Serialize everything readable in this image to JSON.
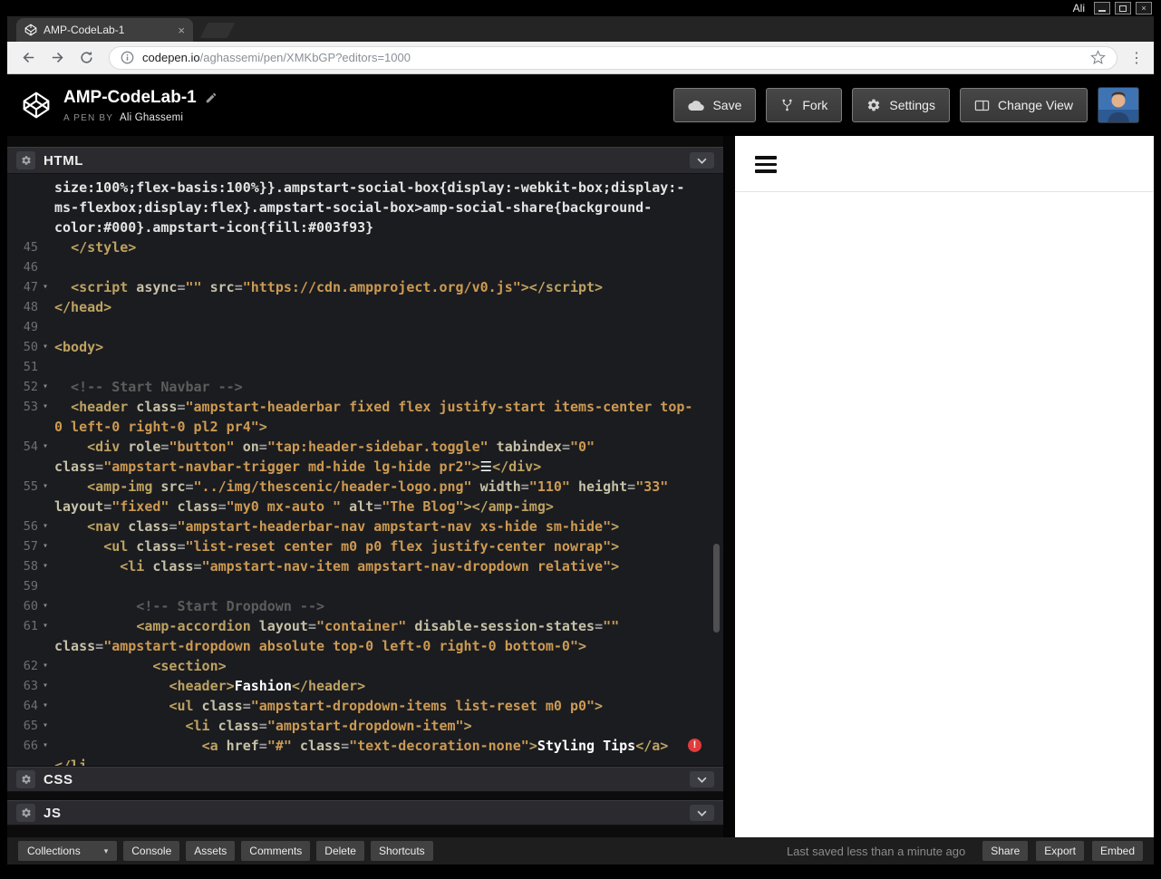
{
  "system_bar": {
    "username": "Ali",
    "window_controls": [
      "minimize",
      "maximize",
      "close"
    ]
  },
  "browser": {
    "tab_title": "AMP-CodeLab-1",
    "tab_close": "×",
    "url_domain": "codepen.io",
    "url_path": "/aghassemi/pen/XMKbGP?editors=1000"
  },
  "header": {
    "title": "AMP-CodeLab-1",
    "byline_prefix": "A PEN BY",
    "author": "Ali Ghassemi",
    "save_label": "Save",
    "fork_label": "Fork",
    "settings_label": "Settings",
    "change_view_label": "Change View"
  },
  "panels": {
    "html": {
      "label": "HTML"
    },
    "css": {
      "label": "CSS"
    },
    "js": {
      "label": "JS"
    }
  },
  "editor": {
    "rows": [
      {
        "num": "",
        "fold": false,
        "segments": [
          [
            "css",
            "size:100%;flex-basis:100%}}.ampstart-social-box{display:-webkit-box;display:-"
          ]
        ]
      },
      {
        "num": "",
        "fold": false,
        "segments": [
          [
            "css",
            "ms-flexbox;display:flex}.ampstart-social-box>amp-social-share{background-"
          ]
        ]
      },
      {
        "num": "",
        "fold": false,
        "segments": [
          [
            "css",
            "color:#000}.ampstart-icon{fill:#003f93}"
          ]
        ]
      },
      {
        "num": "45",
        "fold": false,
        "segments": [
          [
            "plain",
            "  "
          ],
          [
            "tag",
            "</style>"
          ]
        ]
      },
      {
        "num": "46",
        "fold": false,
        "segments": []
      },
      {
        "num": "47",
        "fold": true,
        "segments": [
          [
            "plain",
            "  "
          ],
          [
            "tag",
            "<script"
          ],
          [
            "attr",
            " async"
          ],
          [
            "punct",
            "="
          ],
          [
            "str",
            "\"\""
          ],
          [
            "attr",
            " src"
          ],
          [
            "punct",
            "="
          ],
          [
            "str",
            "\"https://cdn.ampproject.org/v0.js\""
          ],
          [
            "tag",
            "></script>"
          ]
        ]
      },
      {
        "num": "48",
        "fold": false,
        "segments": [
          [
            "tag",
            "</head>"
          ]
        ]
      },
      {
        "num": "49",
        "fold": false,
        "segments": []
      },
      {
        "num": "50",
        "fold": true,
        "segments": [
          [
            "tag",
            "<body>"
          ]
        ]
      },
      {
        "num": "51",
        "fold": false,
        "segments": []
      },
      {
        "num": "52",
        "fold": true,
        "segments": [
          [
            "comment",
            "  <!-- Start Navbar -->"
          ]
        ]
      },
      {
        "num": "53",
        "fold": true,
        "segments": [
          [
            "plain",
            "  "
          ],
          [
            "tag",
            "<header"
          ],
          [
            "attr",
            " class"
          ],
          [
            "punct",
            "="
          ],
          [
            "str",
            "\"ampstart-headerbar fixed flex justify-start items-center top-"
          ]
        ]
      },
      {
        "num": "",
        "fold": false,
        "segments": [
          [
            "str",
            "0 left-0 right-0 pl2 pr4\""
          ],
          [
            "tag",
            ">"
          ]
        ]
      },
      {
        "num": "54",
        "fold": true,
        "segments": [
          [
            "plain",
            "    "
          ],
          [
            "tag",
            "<div"
          ],
          [
            "attr",
            " role"
          ],
          [
            "punct",
            "="
          ],
          [
            "str",
            "\"button\""
          ],
          [
            "attr",
            " on"
          ],
          [
            "punct",
            "="
          ],
          [
            "str",
            "\"tap:header-sidebar.toggle\""
          ],
          [
            "attr",
            " tabindex"
          ],
          [
            "punct",
            "="
          ],
          [
            "str",
            "\"0\""
          ]
        ]
      },
      {
        "num": "",
        "fold": false,
        "segments": [
          [
            "attr",
            "class"
          ],
          [
            "punct",
            "="
          ],
          [
            "str",
            "\"ampstart-navbar-trigger md-hide lg-hide pr2\""
          ],
          [
            "tag",
            ">"
          ],
          [
            "text",
            "☰"
          ],
          [
            "tag",
            "</div>"
          ]
        ]
      },
      {
        "num": "55",
        "fold": true,
        "segments": [
          [
            "plain",
            "    "
          ],
          [
            "tag",
            "<amp-img"
          ],
          [
            "attr",
            " src"
          ],
          [
            "punct",
            "="
          ],
          [
            "str",
            "\"../img/thescenic/header-logo.png\""
          ],
          [
            "attr",
            " width"
          ],
          [
            "punct",
            "="
          ],
          [
            "str",
            "\"110\""
          ],
          [
            "attr",
            " height"
          ],
          [
            "punct",
            "="
          ],
          [
            "str",
            "\"33\""
          ]
        ]
      },
      {
        "num": "",
        "fold": false,
        "segments": [
          [
            "attr",
            "layout"
          ],
          [
            "punct",
            "="
          ],
          [
            "str",
            "\"fixed\""
          ],
          [
            "attr",
            " class"
          ],
          [
            "punct",
            "="
          ],
          [
            "str",
            "\"my0 mx-auto \""
          ],
          [
            "attr",
            " alt"
          ],
          [
            "punct",
            "="
          ],
          [
            "str",
            "\"The Blog\""
          ],
          [
            "tag",
            "></amp-img>"
          ]
        ]
      },
      {
        "num": "56",
        "fold": true,
        "segments": [
          [
            "plain",
            "    "
          ],
          [
            "tag",
            "<nav"
          ],
          [
            "attr",
            " class"
          ],
          [
            "punct",
            "="
          ],
          [
            "str",
            "\"ampstart-headerbar-nav ampstart-nav xs-hide sm-hide\""
          ],
          [
            "tag",
            ">"
          ]
        ]
      },
      {
        "num": "57",
        "fold": true,
        "segments": [
          [
            "plain",
            "      "
          ],
          [
            "tag",
            "<ul"
          ],
          [
            "attr",
            " class"
          ],
          [
            "punct",
            "="
          ],
          [
            "str",
            "\"list-reset center m0 p0 flex justify-center nowrap\""
          ],
          [
            "tag",
            ">"
          ]
        ]
      },
      {
        "num": "58",
        "fold": true,
        "segments": [
          [
            "plain",
            "        "
          ],
          [
            "tag",
            "<li"
          ],
          [
            "attr",
            " class"
          ],
          [
            "punct",
            "="
          ],
          [
            "str",
            "\"ampstart-nav-item ampstart-nav-dropdown relative\""
          ],
          [
            "tag",
            ">"
          ]
        ]
      },
      {
        "num": "59",
        "fold": false,
        "segments": []
      },
      {
        "num": "60",
        "fold": true,
        "segments": [
          [
            "comment",
            "          <!-- Start Dropdown -->"
          ]
        ]
      },
      {
        "num": "61",
        "fold": true,
        "segments": [
          [
            "plain",
            "          "
          ],
          [
            "tag",
            "<amp-accordion"
          ],
          [
            "attr",
            " layout"
          ],
          [
            "punct",
            "="
          ],
          [
            "str",
            "\"container\""
          ],
          [
            "attr",
            " disable-session-states"
          ],
          [
            "punct",
            "="
          ],
          [
            "str",
            "\"\""
          ]
        ]
      },
      {
        "num": "",
        "fold": false,
        "segments": [
          [
            "attr",
            "class"
          ],
          [
            "punct",
            "="
          ],
          [
            "str",
            "\"ampstart-dropdown absolute top-0 left-0 right-0 bottom-0\""
          ],
          [
            "tag",
            ">"
          ]
        ]
      },
      {
        "num": "62",
        "fold": true,
        "segments": [
          [
            "plain",
            "            "
          ],
          [
            "tag",
            "<section>"
          ]
        ]
      },
      {
        "num": "63",
        "fold": true,
        "segments": [
          [
            "plain",
            "              "
          ],
          [
            "tag",
            "<header>"
          ],
          [
            "text",
            "Fashion"
          ],
          [
            "tag",
            "</header>"
          ]
        ]
      },
      {
        "num": "64",
        "fold": true,
        "segments": [
          [
            "plain",
            "              "
          ],
          [
            "tag",
            "<ul"
          ],
          [
            "attr",
            " class"
          ],
          [
            "punct",
            "="
          ],
          [
            "str",
            "\"ampstart-dropdown-items list-reset m0 p0\""
          ],
          [
            "tag",
            ">"
          ]
        ]
      },
      {
        "num": "65",
        "fold": true,
        "segments": [
          [
            "plain",
            "                "
          ],
          [
            "tag",
            "<li"
          ],
          [
            "attr",
            " class"
          ],
          [
            "punct",
            "="
          ],
          [
            "str",
            "\"ampstart-dropdown-item\""
          ],
          [
            "tag",
            ">"
          ]
        ]
      },
      {
        "num": "66",
        "fold": true,
        "error": true,
        "segments": [
          [
            "plain",
            "                  "
          ],
          [
            "tag",
            "<a"
          ],
          [
            "attr",
            " href"
          ],
          [
            "punct",
            "="
          ],
          [
            "str",
            "\"#\""
          ],
          [
            "attr",
            " class"
          ],
          [
            "punct",
            "="
          ],
          [
            "str",
            "\"text-decoration-none\""
          ],
          [
            "tag",
            ">"
          ],
          [
            "text",
            "Styling Tips"
          ],
          [
            "tag",
            "</a>"
          ]
        ]
      },
      {
        "num": "",
        "fold": false,
        "segments": [
          [
            "tag",
            "</li"
          ]
        ]
      }
    ],
    "error_glyph": "!"
  },
  "footer": {
    "collections_label": "Collections",
    "buttons_left": [
      "Console",
      "Assets",
      "Comments",
      "Delete",
      "Shortcuts"
    ],
    "status": "Last saved less than a minute ago",
    "buttons_right": [
      "Share",
      "Export",
      "Embed"
    ]
  },
  "icons": {
    "codepen-logo-icon": "cube-outline",
    "pencil-icon": "pencil",
    "save-icon": "cloud",
    "fork-icon": "git-fork",
    "settings-icon": "gear",
    "change-view-icon": "layout-split",
    "back-icon": "arrow-left",
    "forward-icon": "arrow-right",
    "reload-icon": "refresh",
    "info-icon": "info-circle",
    "star-icon": "star-outline",
    "overflow-menu-icon": "vertical-dots",
    "chevron-down-icon": "chevron-down",
    "panel-settings-icon": "gear",
    "lint-error-icon": "exclamation-circle",
    "hamburger-icon": "three-bars",
    "fold-arrow-icon": "triangle-down"
  },
  "colors": {
    "error_red": "#e03c3c",
    "editor_bg": "#1b1c20",
    "panel_header_bg": "#2a2a2f",
    "tag": "#bda262",
    "string": "#cc9a52",
    "comment": "#5d5d5d",
    "footer_bg": "#1e1e1e",
    "toolbar_bg": "#f1f1f1",
    "icon_fill_note": "#003f93"
  }
}
